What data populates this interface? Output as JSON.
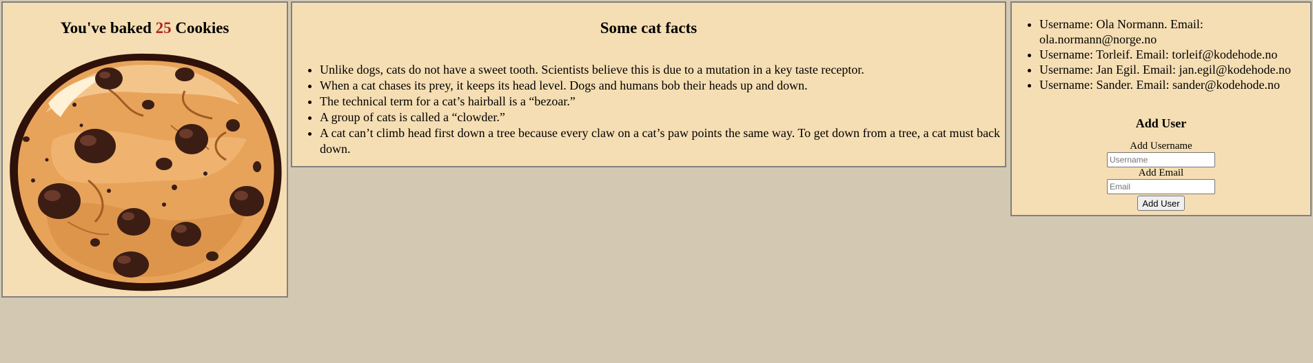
{
  "cookie": {
    "prefix": "You've baked",
    "count": "25",
    "suffix": "Cookies"
  },
  "facts": {
    "title": "Some cat facts",
    "items": [
      "Unlike dogs, cats do not have a sweet tooth. Scientists believe this is due to a mutation in a key taste receptor.",
      "When a cat chases its prey, it keeps its head level. Dogs and humans bob their heads up and down.",
      "The technical term for a cat’s hairball is a “bezoar.”",
      "A group of cats is called a “clowder.”",
      "A cat can’t climb head first down a tree because every claw on a cat’s paw points the same way. To get down from a tree, a cat must back down."
    ]
  },
  "users": {
    "items": [
      "Username: Ola Normann. Email: ola.normann@norge.no",
      "Username: Torleif. Email: torleif@kodehode.no",
      "Username: Jan Egil. Email: jan.egil@kodehode.no",
      "Username: Sander. Email: sander@kodehode.no"
    ]
  },
  "add_user": {
    "title": "Add User",
    "username_label": "Add Username",
    "username_placeholder": "Username",
    "email_label": "Add Email",
    "email_placeholder": "Email",
    "button_label": "Add User"
  },
  "colors": {
    "page_background": "#d3c8b2",
    "panel_background": "#f5deb3",
    "count_color": "#b0261c"
  },
  "icons": {
    "cookie": "chocolate-chip-cookie-icon"
  }
}
